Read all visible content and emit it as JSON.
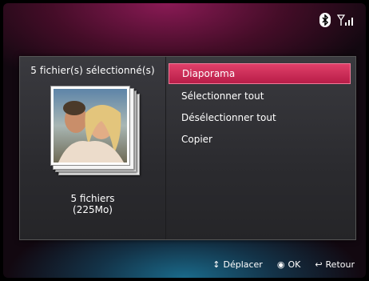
{
  "status": {
    "bluetooth_icon": "bluetooth-icon",
    "signal_icon": "signal-strength-icon"
  },
  "left": {
    "title": "5 fichier(s) sélectionné(s)",
    "count_line1": "5 fichiers",
    "count_line2": "(225Mo)"
  },
  "menu": {
    "items": [
      {
        "label": "Diaporama",
        "active": true
      },
      {
        "label": "Sélectionner tout",
        "active": false
      },
      {
        "label": "Désélectionner tout",
        "active": false
      },
      {
        "label": "Copier",
        "active": false
      }
    ]
  },
  "footer": {
    "move_icon": "↕",
    "move_label": "Déplacer",
    "ok_icon": "◉",
    "ok_label": "OK",
    "back_icon": "↩",
    "back_label": "Retour"
  },
  "colors": {
    "accent": "#c8284f",
    "panel": "#2e2e32"
  }
}
